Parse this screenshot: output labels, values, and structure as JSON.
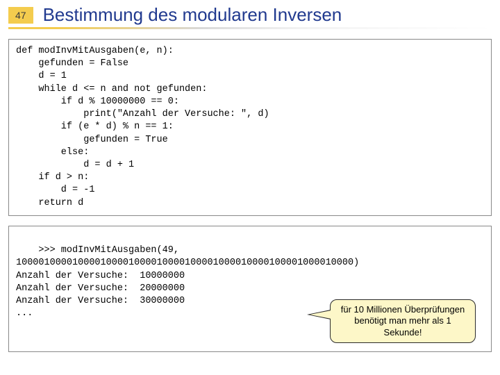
{
  "header": {
    "page_number": "47",
    "title": "Bestimmung des modularen Inversen"
  },
  "code_block": {
    "text": "def modInvMitAusgaben(e, n):\n    gefunden = False\n    d = 1\n    while d <= n and not gefunden:\n        if d % 10000000 == 0:\n            print(\"Anzahl der Versuche: \", d)\n        if (e * d) % n == 1:\n            gefunden = True\n        else:\n            d = d + 1\n    if d > n:\n        d = -1\n    return d"
  },
  "output_block": {
    "text": ">>> modInvMitAusgaben(49,\n100001000010000100001000010000100001000010000100001000010000)\nAnzahl der Versuche:  10000000\nAnzahl der Versuche:  20000000\nAnzahl der Versuche:  30000000\n..."
  },
  "callout": {
    "text": "für 10 Millionen Überprüfungen benötigt man mehr als 1 Sekunde!"
  }
}
